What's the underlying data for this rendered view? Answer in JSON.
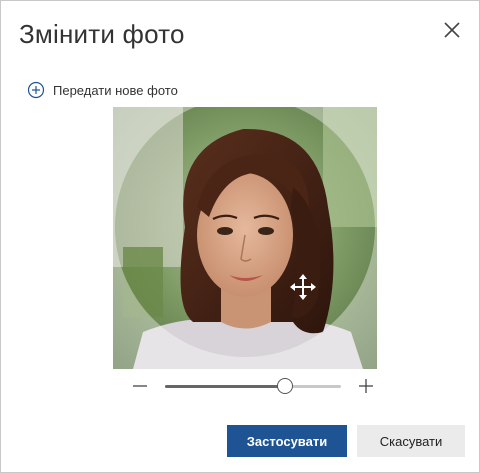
{
  "dialog": {
    "title": "Змінити фото",
    "upload_label": "Передати нове фото",
    "zoom_level": 0.68,
    "apply_label": "Застосувати",
    "cancel_label": "Скасувати"
  },
  "icons": {
    "close": "close-icon",
    "upload": "add-circle-icon",
    "move": "move-icon",
    "zoom_out": "minus-icon",
    "zoom_in": "plus-icon"
  },
  "colors": {
    "primary_button": "#1e5494",
    "secondary_button": "#ebebeb"
  }
}
